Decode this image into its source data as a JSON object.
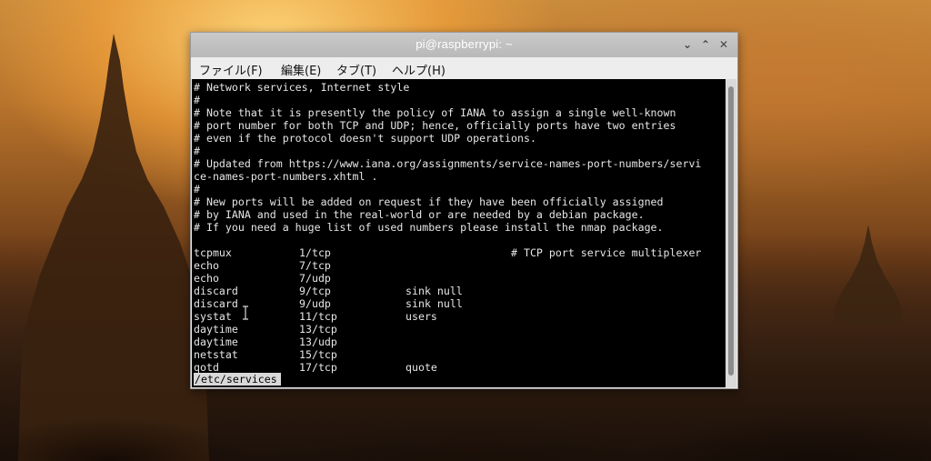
{
  "window": {
    "title": "pi@raspberrypi: ~",
    "controls": {
      "minimize": "⌄",
      "maximize": "⌃",
      "close": "✕"
    }
  },
  "menu": [
    {
      "label": "ファイル(F)"
    },
    {
      "label": "編集(E)"
    },
    {
      "label": "タブ(T)"
    },
    {
      "label": "ヘルプ(H)"
    }
  ],
  "comments": [
    "# Network services, Internet style",
    "#",
    "# Note that it is presently the policy of IANA to assign a single well-known",
    "# port number for both TCP and UDP; hence, officially ports have two entries",
    "# even if the protocol doesn't support UDP operations.",
    "#",
    "# Updated from https://www.iana.org/assignments/service-names-port-numbers/servi",
    "ce-names-port-numbers.xhtml .",
    "#",
    "# New ports will be added on request if they have been officially assigned",
    "# by IANA and used in the real-world or are needed by a debian package.",
    "# If you need a huge list of used numbers please install the nmap package."
  ],
  "services": [
    {
      "name": "tcpmux",
      "port": "1/tcp",
      "aliases": "",
      "comment": "# TCP port service multiplexer"
    },
    {
      "name": "echo",
      "port": "7/tcp",
      "aliases": "",
      "comment": ""
    },
    {
      "name": "echo",
      "port": "7/udp",
      "aliases": "",
      "comment": ""
    },
    {
      "name": "discard",
      "port": "9/tcp",
      "aliases": "sink null",
      "comment": ""
    },
    {
      "name": "discard",
      "port": "9/udp",
      "aliases": "sink null",
      "comment": ""
    },
    {
      "name": "systat",
      "port": "11/tcp",
      "aliases": "users",
      "comment": ""
    },
    {
      "name": "daytime",
      "port": "13/tcp",
      "aliases": "",
      "comment": ""
    },
    {
      "name": "daytime",
      "port": "13/udp",
      "aliases": "",
      "comment": ""
    },
    {
      "name": "netstat",
      "port": "15/tcp",
      "aliases": "",
      "comment": ""
    },
    {
      "name": "qotd",
      "port": "17/tcp",
      "aliases": "quote",
      "comment": ""
    }
  ],
  "status_line": "/etc/services"
}
